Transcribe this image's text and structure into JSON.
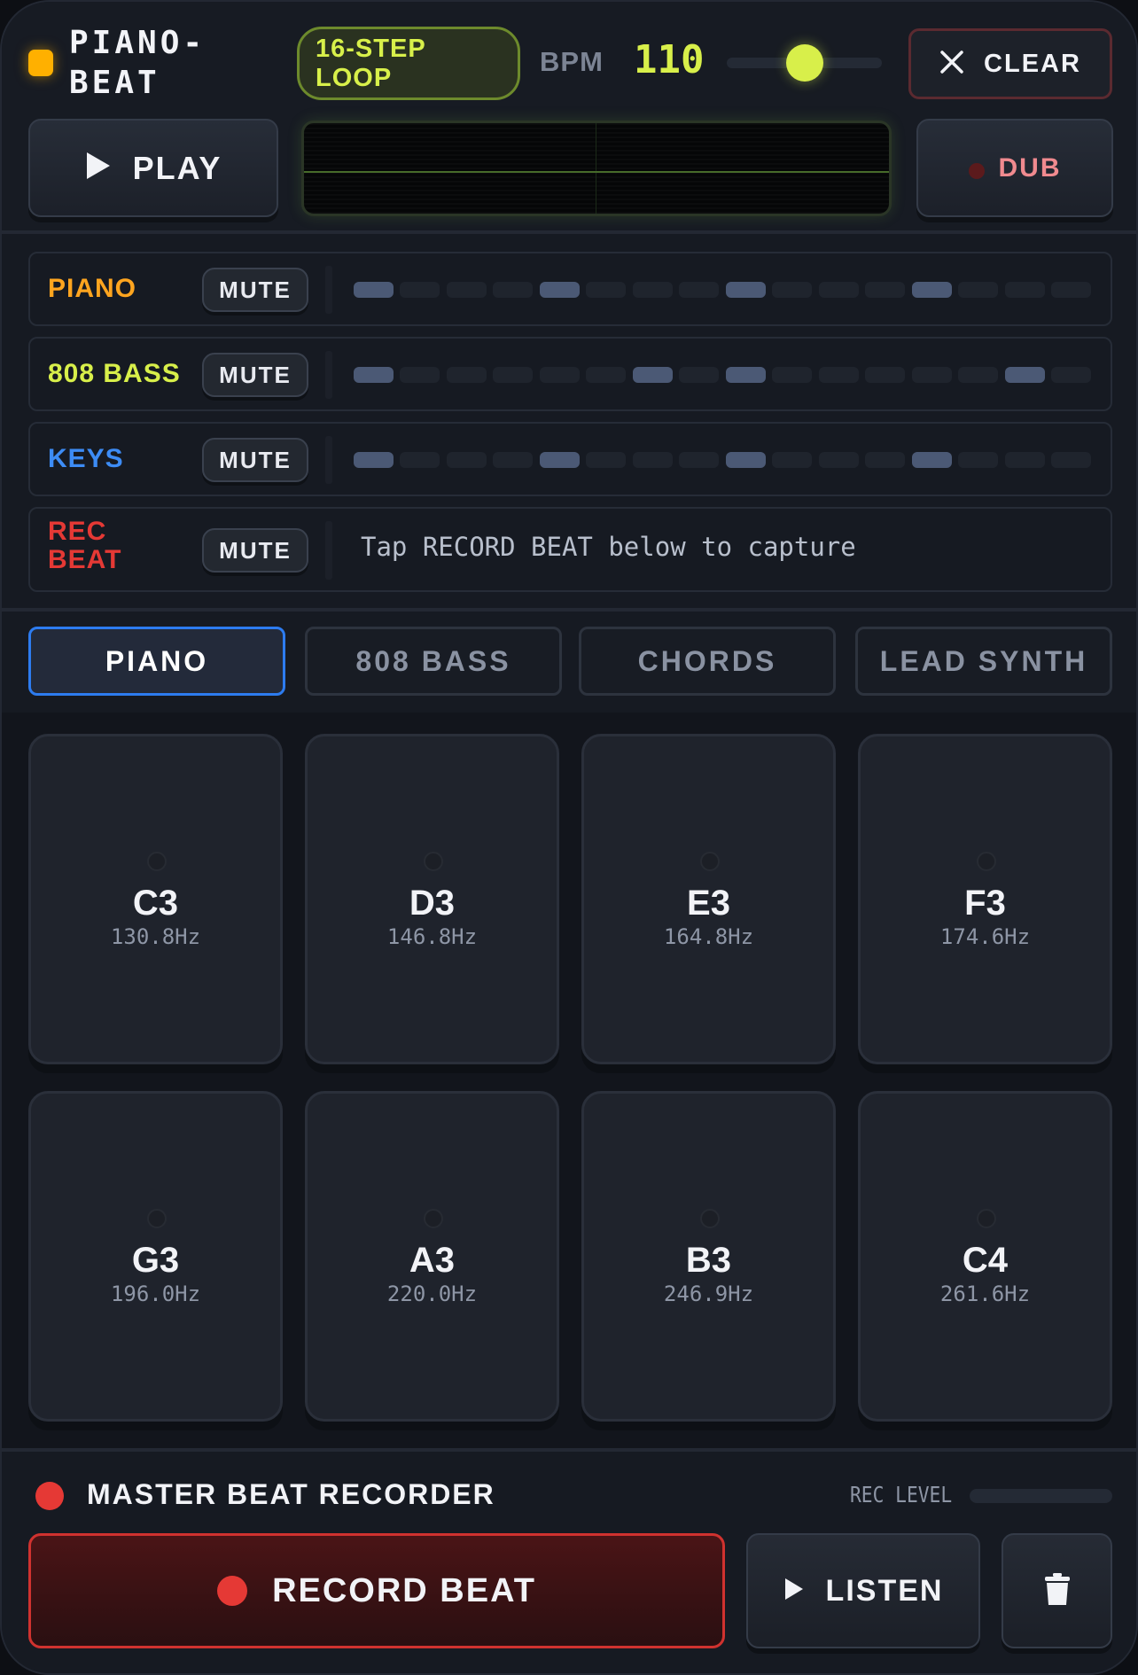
{
  "header": {
    "logo_text": "PIANO-\nBEAT",
    "logo_color": "#ffb000",
    "loop_badge": "16-STEP\nLOOP",
    "bpm_label": "BPM",
    "bpm_value": "110",
    "bpm_slider_fraction": 0.5,
    "clear_label": "CLEAR",
    "play_label": "PLAY",
    "dub_label": "DUB"
  },
  "tracks": [
    {
      "name": "PIANO",
      "color": "#ffa51f",
      "mute_label": "MUTE",
      "steps": [
        1,
        0,
        0,
        0,
        1,
        0,
        0,
        0,
        1,
        0,
        0,
        0,
        1,
        0,
        0,
        0
      ]
    },
    {
      "name": "808 BASS",
      "color": "#d8ef4a",
      "mute_label": "MUTE",
      "steps": [
        1,
        0,
        0,
        0,
        0,
        0,
        1,
        0,
        1,
        0,
        0,
        0,
        0,
        0,
        1,
        0
      ]
    },
    {
      "name": "KEYS",
      "color": "#3d8cf5",
      "mute_label": "MUTE",
      "steps": [
        1,
        0,
        0,
        0,
        1,
        0,
        0,
        0,
        1,
        0,
        0,
        0,
        1,
        0,
        0,
        0
      ]
    },
    {
      "name": "REC\nBEAT",
      "color": "#e53935",
      "mute_label": "MUTE",
      "hint": "Tap RECORD BEAT below to capture"
    }
  ],
  "instrument_tabs": [
    {
      "label": "PIANO",
      "active": true
    },
    {
      "label": "808 BASS",
      "active": false
    },
    {
      "label": "CHORDS",
      "active": false
    },
    {
      "label": "LEAD SYNTH",
      "active": false
    }
  ],
  "pads": [
    {
      "note": "C3",
      "freq": "130.8Hz"
    },
    {
      "note": "D3",
      "freq": "146.8Hz"
    },
    {
      "note": "E3",
      "freq": "164.8Hz"
    },
    {
      "note": "F3",
      "freq": "174.6Hz"
    },
    {
      "note": "G3",
      "freq": "196.0Hz"
    },
    {
      "note": "A3",
      "freq": "220.0Hz"
    },
    {
      "note": "B3",
      "freq": "246.9Hz"
    },
    {
      "note": "C4",
      "freq": "261.6Hz"
    }
  ],
  "recorder": {
    "title": "MASTER BEAT RECORDER",
    "level_label": "REC LEVEL",
    "level_fraction": 0,
    "record_label": "RECORD BEAT",
    "listen_label": "LISTEN",
    "trash_icon": "trash-icon",
    "accent": "#e53935"
  }
}
